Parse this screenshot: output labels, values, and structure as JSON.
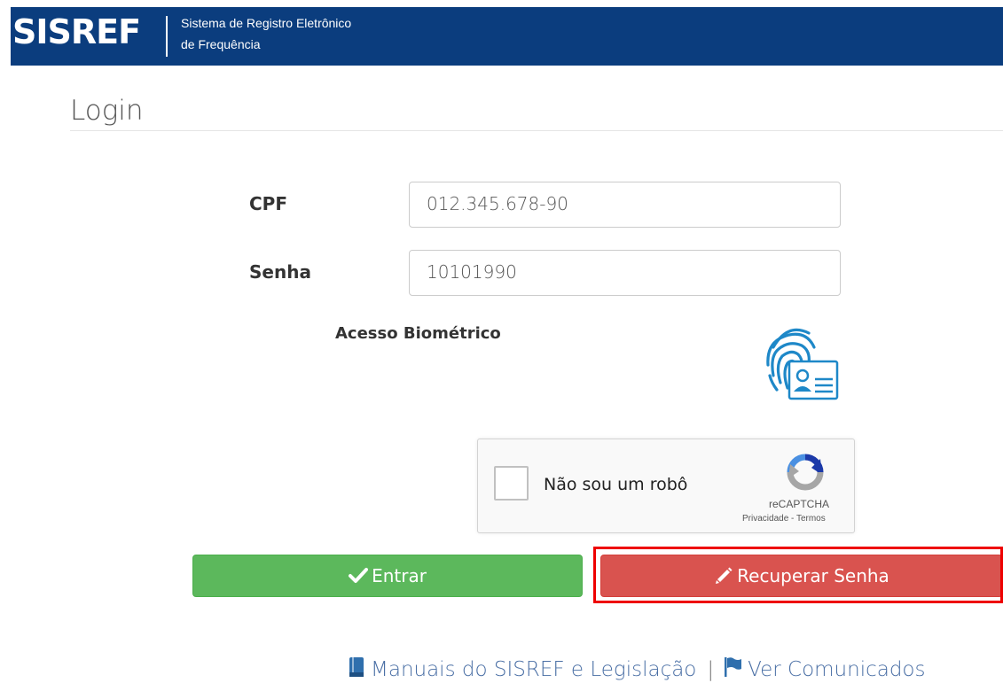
{
  "header": {
    "logo": "SISREF",
    "subtitle_line1": "Sistema de Registro Eletrônico",
    "subtitle_line2": "de Frequência",
    "background_color": "#0b3d7e"
  },
  "page_title": "Login",
  "form": {
    "cpf_label": "CPF",
    "cpf_value": "012.345.678-90",
    "senha_label": "Senha",
    "senha_value": "10101990",
    "biometric_label": "Acesso Biométrico",
    "biometric_icon": "fingerprint-id-card-icon"
  },
  "captcha": {
    "label": "Não sou um robô",
    "brand": "reCAPTCHA",
    "links": "Privacidade - Termos",
    "checked": false
  },
  "buttons": {
    "entrar_label": "Entrar",
    "entrar_icon": "checkmark-icon",
    "entrar_color": "#5cb85c",
    "recuperar_label": "Recuperar Senha",
    "recuperar_icon": "pencil-icon",
    "recuperar_color": "#d9534f",
    "highlight_color": "#ee0000"
  },
  "footer": {
    "manuals_label": "Manuais do SISREF e Legislação",
    "manuals_icon": "book-icon",
    "separator": "|",
    "comunicados_label": "Ver Comunicados",
    "comunicados_icon": "flag-icon"
  }
}
